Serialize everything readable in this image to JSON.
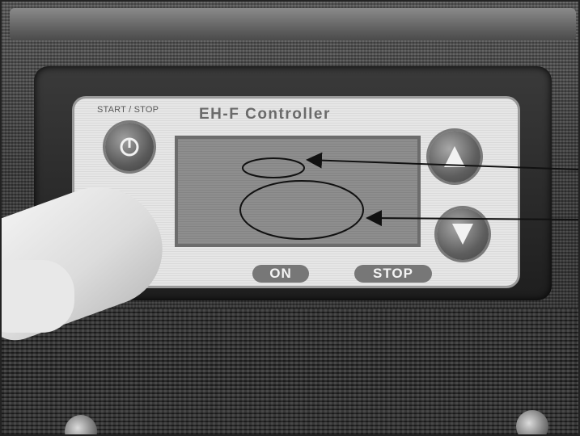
{
  "controller": {
    "start_stop_label": "START / STOP",
    "brand": "EH-F Controller",
    "led_on_label": "ON",
    "led_stop_label": "STOP"
  },
  "icons": {
    "power": "power-icon",
    "up": "triangle-up-icon",
    "down": "triangle-down-icon"
  }
}
